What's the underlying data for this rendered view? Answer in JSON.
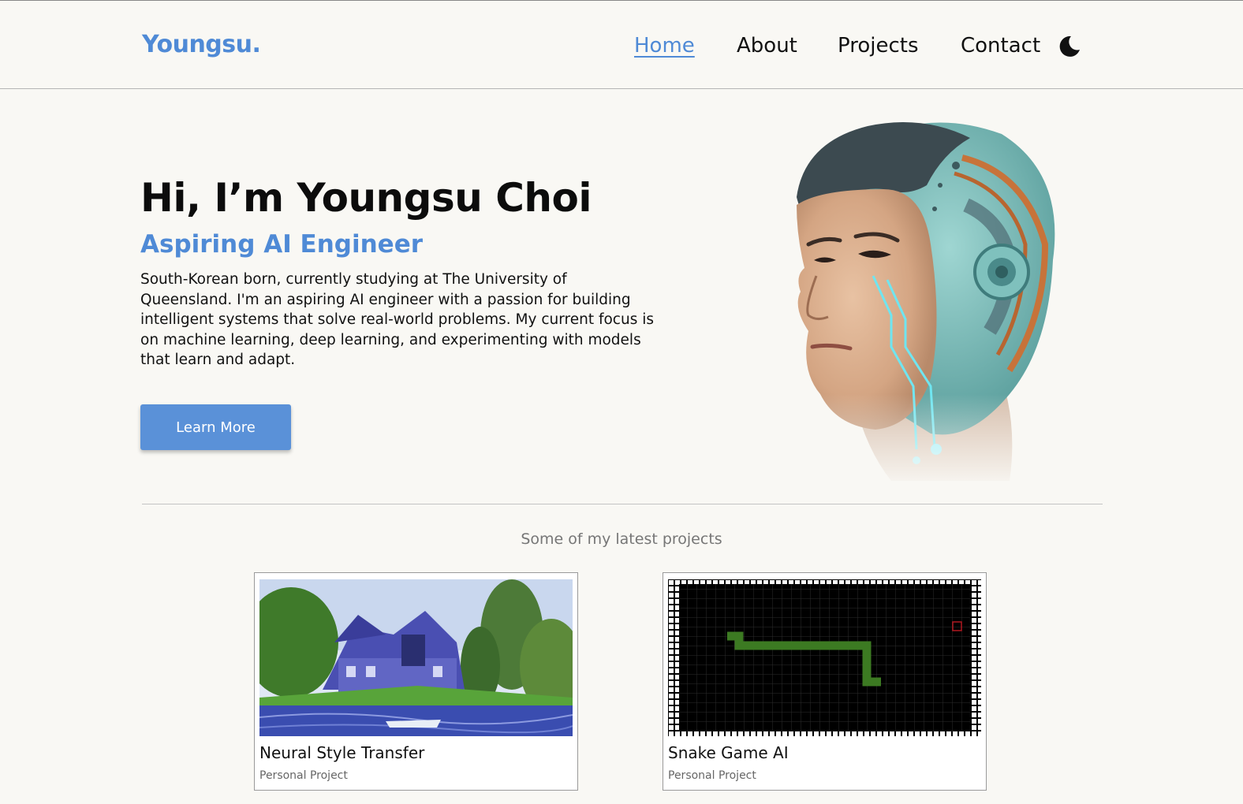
{
  "header": {
    "logo": "Youngsu.",
    "nav": [
      {
        "label": "Home",
        "active": true
      },
      {
        "label": "About",
        "active": false
      },
      {
        "label": "Projects",
        "active": false
      },
      {
        "label": "Contact",
        "active": false
      }
    ],
    "theme_icon": "moon-icon"
  },
  "hero": {
    "title": "Hi, I’m Youngsu Choi",
    "subtitle": "Aspiring AI Engineer",
    "description": "South-Korean born, currently studying at The University of Queensland. I'm an aspiring AI engineer with a passion for building intelligent systems that solve real-world problems. My current focus is on machine learning, deep learning, and experimenting with models that learn and adapt.",
    "button_label": "Learn More"
  },
  "projects": {
    "caption": "Some of my latest projects",
    "items": [
      {
        "title": "Neural Style Transfer",
        "category": "Personal Project"
      },
      {
        "title": "Snake Game AI",
        "category": "Personal Project"
      }
    ]
  },
  "colors": {
    "accent": "#4f8ad6",
    "background": "#f9f8f4",
    "button": "#5a91d8"
  }
}
